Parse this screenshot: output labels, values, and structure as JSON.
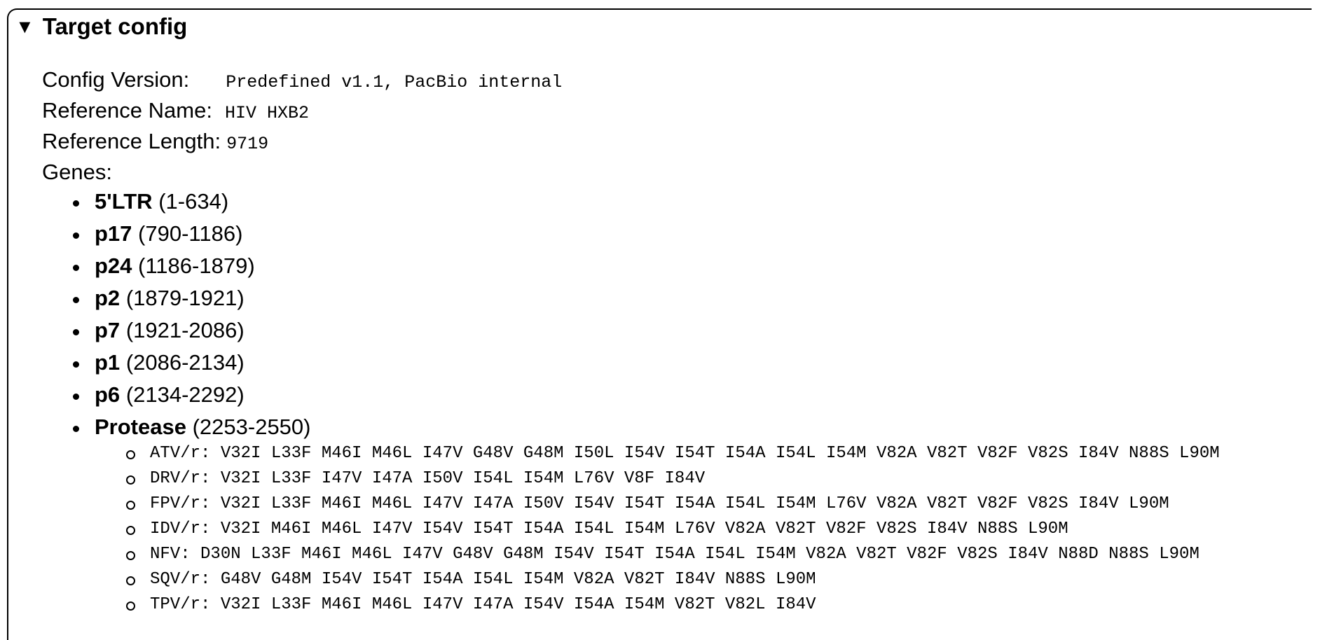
{
  "section": {
    "title": "Target config",
    "expanded": true
  },
  "config": {
    "version_label": "Config Version:",
    "version_value": "Predefined v1.1, PacBio internal",
    "ref_name_label": "Reference Name:",
    "ref_name_value": "HIV HXB2",
    "ref_length_label": "Reference Length:",
    "ref_length_value": "9719",
    "genes_label": "Genes:"
  },
  "genes": [
    {
      "name": "5'LTR",
      "range": "(1-634)"
    },
    {
      "name": "p17",
      "range": "(790-1186)"
    },
    {
      "name": "p24",
      "range": "(1186-1879)"
    },
    {
      "name": "p2",
      "range": "(1879-1921)"
    },
    {
      "name": "p7",
      "range": "(1921-2086)"
    },
    {
      "name": "p1",
      "range": "(2086-2134)"
    },
    {
      "name": "p6",
      "range": "(2134-2292)"
    },
    {
      "name": "Protease",
      "range": "(2253-2550)"
    }
  ],
  "protease_drugs": [
    "ATV/r: V32I L33F M46I M46L I47V G48V G48M I50L I54V I54T I54A I54L I54M V82A V82T V82F V82S I84V N88S L90M",
    "DRV/r: V32I L33F I47V I47A I50V I54L I54M L76V V8F I84V",
    "FPV/r: V32I L33F M46I M46L I47V I47A I50V I54V I54T I54A I54L I54M L76V V82A V82T V82F V82S I84V L90M",
    "IDV/r: V32I M46I M46L I47V I54V I54T I54A I54L I54M L76V V82A V82T V82F V82S I84V N88S L90M",
    "NFV: D30N L33F M46I M46L I47V G48V G48M I54V I54T I54A I54L I54M V82A V82T V82F V82S I84V N88D N88S L90M",
    "SQV/r: G48V G48M I54V I54T I54A I54L I54M V82A V82T I84V N88S L90M",
    "TPV/r: V32I L33F M46I M46L I47V I47A I54V I54A I54M V82T V82L I84V"
  ]
}
